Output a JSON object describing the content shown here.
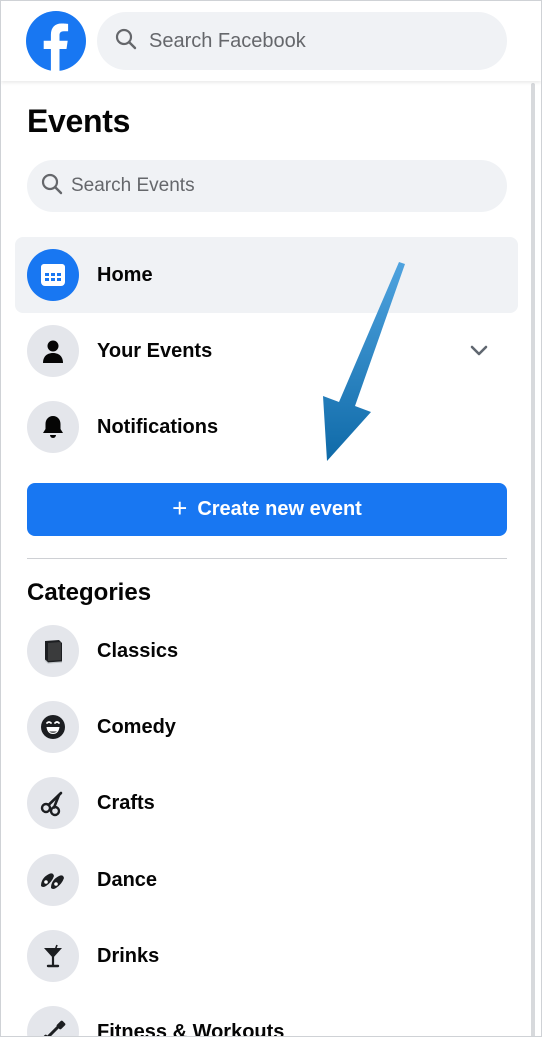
{
  "header": {
    "search_placeholder": "Search Facebook",
    "logo_icon": "facebook-logo-icon",
    "brand_color": "#1877f2"
  },
  "sidebar": {
    "title": "Events",
    "search_placeholder": "Search Events",
    "nav_items": [
      {
        "label": "Home",
        "icon": "calendar-icon",
        "active": true
      },
      {
        "label": "Your Events",
        "icon": "person-icon",
        "has_chevron": true
      },
      {
        "label": "Notifications",
        "icon": "bell-icon"
      }
    ],
    "create_button": {
      "icon": "plus-icon",
      "label": "Create new event"
    },
    "categories_title": "Categories",
    "categories": [
      {
        "label": "Classics",
        "icon": "book-icon"
      },
      {
        "label": "Comedy",
        "icon": "laughing-face-icon"
      },
      {
        "label": "Crafts",
        "icon": "scissors-icon"
      },
      {
        "label": "Dance",
        "icon": "ballet-shoes-icon"
      },
      {
        "label": "Drinks",
        "icon": "cocktail-glass-icon"
      },
      {
        "label": "Fitness & Workouts",
        "icon": "fitness-icon"
      }
    ]
  },
  "annotation": {
    "icon": "pointer-arrow-icon",
    "color": "#1a78c2"
  }
}
